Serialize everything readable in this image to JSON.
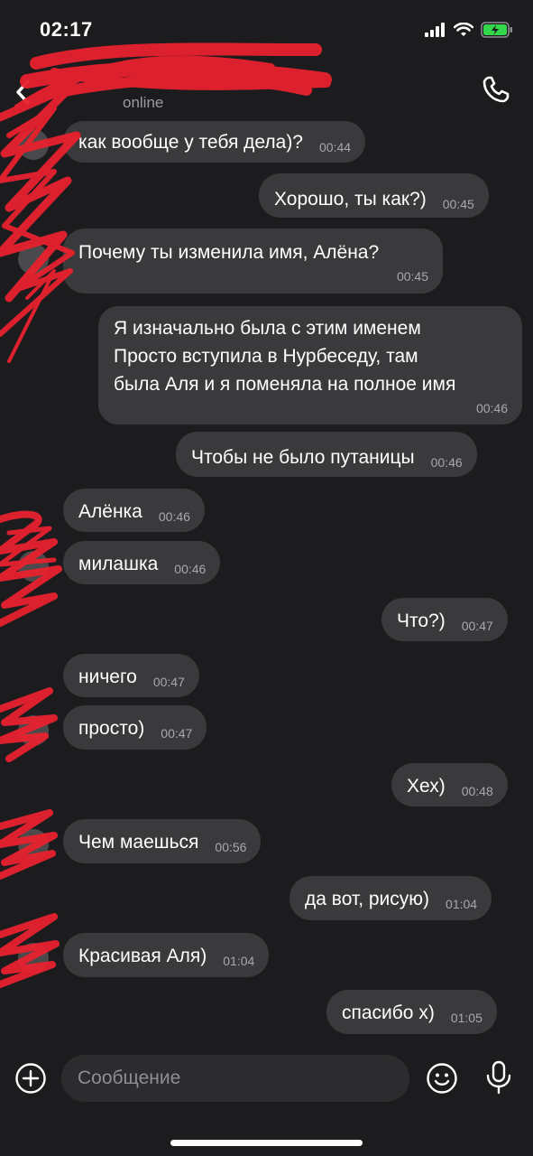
{
  "status_bar": {
    "time": "02:17"
  },
  "header": {
    "contact_name": "",
    "contact_status": "online"
  },
  "messages": [
    {
      "direction": "in",
      "text": "как вообще у тебя дела)?",
      "time": "00:44"
    },
    {
      "direction": "out",
      "text": "Хорошо, ты как?)",
      "time": "00:45"
    },
    {
      "direction": "in",
      "text": "Почему ты изменила имя, Алёна?",
      "time": "00:45"
    },
    {
      "direction": "out",
      "text": "Я изначально была с этим именем\nПросто вступила в Нурбеседу, там\nбыла Аля и я поменяла на полное имя",
      "time": "00:46"
    },
    {
      "direction": "out",
      "text": "Чтобы не было путаницы",
      "time": "00:46"
    },
    {
      "direction": "in",
      "text": "Алёнка",
      "time": "00:46"
    },
    {
      "direction": "in",
      "text": "милашка",
      "time": "00:46"
    },
    {
      "direction": "out",
      "text": "Что?)",
      "time": "00:47"
    },
    {
      "direction": "in",
      "text": "ничего",
      "time": "00:47"
    },
    {
      "direction": "in",
      "text": "просто)",
      "time": "00:47"
    },
    {
      "direction": "out",
      "text": "Хех)",
      "time": "00:48"
    },
    {
      "direction": "in",
      "text": "Чем маешься",
      "time": "00:56"
    },
    {
      "direction": "out",
      "text": "да вот, рисую)",
      "time": "01:04"
    },
    {
      "direction": "in",
      "text": "Красивая Аля)",
      "time": "01:04"
    },
    {
      "direction": "out",
      "text": "спасибо х)",
      "time": "01:05"
    }
  ],
  "composer": {
    "placeholder": "Сообщение"
  },
  "colors": {
    "background": "#1c1c1e",
    "bubble": "#3a3a3c",
    "input_background": "#2c2c2e",
    "redaction": "#e8212e"
  },
  "icons": {
    "back": "chevron-left-icon",
    "call": "phone-icon",
    "attach": "plus-circle-icon",
    "emoji": "smiley-icon",
    "mic": "microphone-icon"
  }
}
